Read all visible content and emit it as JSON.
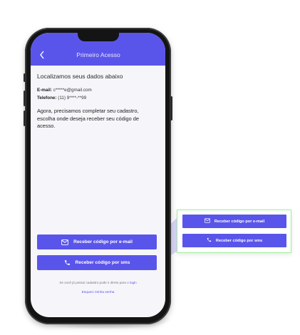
{
  "header": {
    "title": "Primeiro Acesso",
    "back_icon": "chevron-left-icon"
  },
  "content": {
    "heading": "Localizamos seus dados abaixo",
    "email_label": "E-mail:",
    "email_value": "c*****e@gmail.com",
    "phone_label": "Telefone:",
    "phone_value": "(11) 9****-**99",
    "description": "Agora, precisamos completar seu cadastro, escolha onde deseja receber seu código de acesso."
  },
  "buttons": {
    "email_label": "Receber código por e-mail",
    "sms_label": "Receber código por sms",
    "email_icon": "mail-icon",
    "sms_icon": "phone-icon"
  },
  "footer": {
    "prompt": "Se você já possui cadastro pode ir direto para o",
    "login_link": "login",
    "forgot_link": "Esqueci minha senha"
  },
  "zoom": {
    "email_label": "Receber código por e-mail",
    "sms_label": "Receber código por sms"
  },
  "colors": {
    "primary": "#5a55ea",
    "highlight_border": "#9cf09a",
    "zoom_fill": "#ccc9fa"
  }
}
